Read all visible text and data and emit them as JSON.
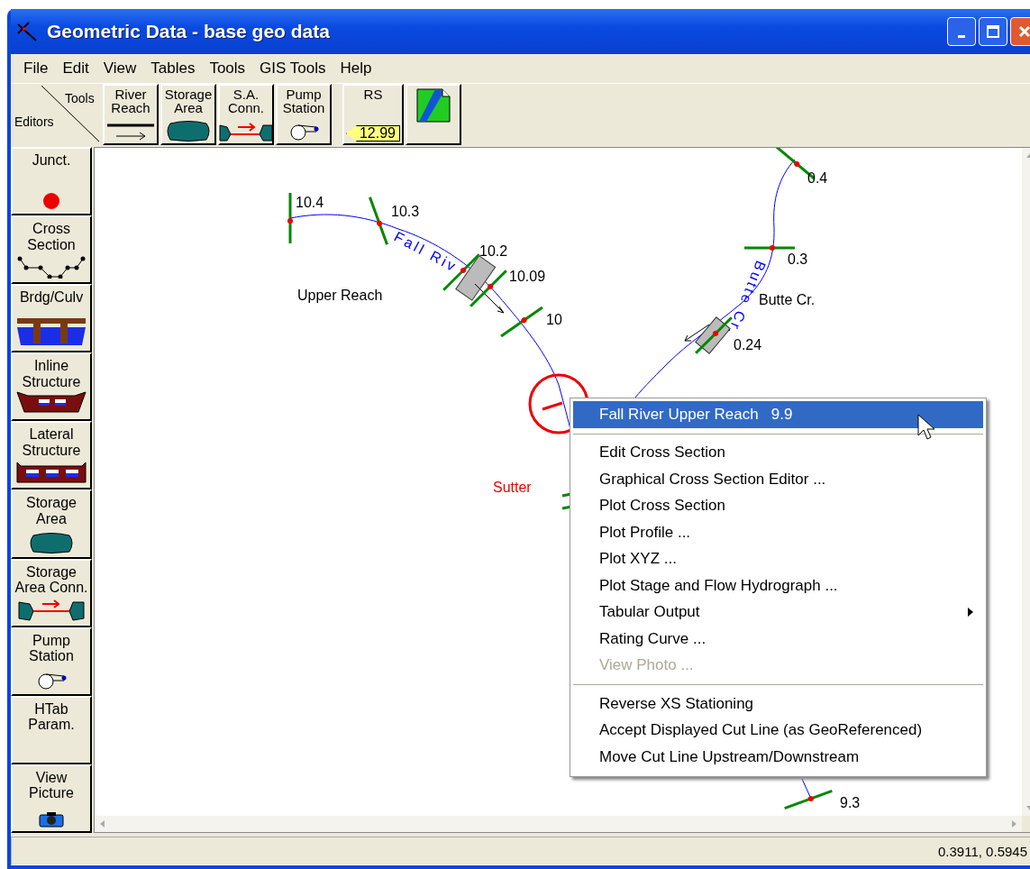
{
  "window": {
    "title": "Geometric Data - base geo data"
  },
  "menu_bar": [
    "File",
    "Edit",
    "View",
    "Tables",
    "Tools",
    "GIS Tools",
    "Help"
  ],
  "toolbar": {
    "corner": {
      "top": "Tools",
      "bottom": "Editors"
    },
    "tools": [
      {
        "kind": "reach",
        "label": "River Reach"
      },
      {
        "kind": "storage",
        "label": "Storage Area"
      },
      {
        "kind": "conn",
        "label": "S.A. Conn."
      },
      {
        "kind": "pump",
        "label": "Pump Station"
      },
      {
        "kind": "rs",
        "label": "RS",
        "tag": "12.99"
      },
      {
        "kind": "map"
      }
    ]
  },
  "editors": [
    {
      "label": "Junct."
    },
    {
      "label": "Cross Section"
    },
    {
      "label": "Brdg/Culv"
    },
    {
      "label": "Inline Structure"
    },
    {
      "label": "Lateral Structure"
    },
    {
      "label": "Storage Area"
    },
    {
      "label": "Storage Area Conn."
    },
    {
      "label": "Pump Station"
    },
    {
      "label": "HTab Param."
    },
    {
      "label": "View Picture"
    }
  ],
  "canvas": {
    "reaches": [
      "Upper Reach",
      "Butte Cr."
    ],
    "rivers": [
      "Fall Riv",
      "Butte Cr."
    ],
    "junction": "Sutter",
    "cross_sections": [
      "10.4",
      "10.3",
      "10.2",
      "10.09",
      "10",
      "0.4",
      "0.3",
      "0.24",
      "9.3"
    ]
  },
  "context_menu": [
    {
      "kind": "header",
      "label": "Fall River Upper Reach   9.9",
      "selected": true
    },
    {
      "kind": "separator"
    },
    {
      "kind": "item",
      "label": "Edit Cross Section",
      "disabled": false
    },
    {
      "kind": "item",
      "label": "Graphical Cross Section Editor ...",
      "disabled": false
    },
    {
      "kind": "item",
      "label": "Plot Cross Section",
      "disabled": false
    },
    {
      "kind": "item",
      "label": "Plot Profile ...",
      "disabled": false
    },
    {
      "kind": "item",
      "label": "Plot XYZ ...",
      "disabled": false
    },
    {
      "kind": "item",
      "label": "Plot Stage and Flow Hydrograph ...",
      "disabled": false
    },
    {
      "kind": "submenu",
      "label": "Tabular Output",
      "disabled": false
    },
    {
      "kind": "item",
      "label": "Rating Curve ...",
      "disabled": false
    },
    {
      "kind": "item",
      "label": "View Photo ...",
      "disabled": true
    },
    {
      "kind": "separator"
    },
    {
      "kind": "item",
      "label": "Reverse XS Stationing",
      "disabled": false
    },
    {
      "kind": "item",
      "label": "Accept Displayed Cut Line (as GeoReferenced)",
      "disabled": false
    },
    {
      "kind": "item",
      "label": "Move Cut Line Upstream/Downstream",
      "disabled": false
    }
  ],
  "status_bar": {
    "coordinates": "0.3911, 0.5945"
  }
}
